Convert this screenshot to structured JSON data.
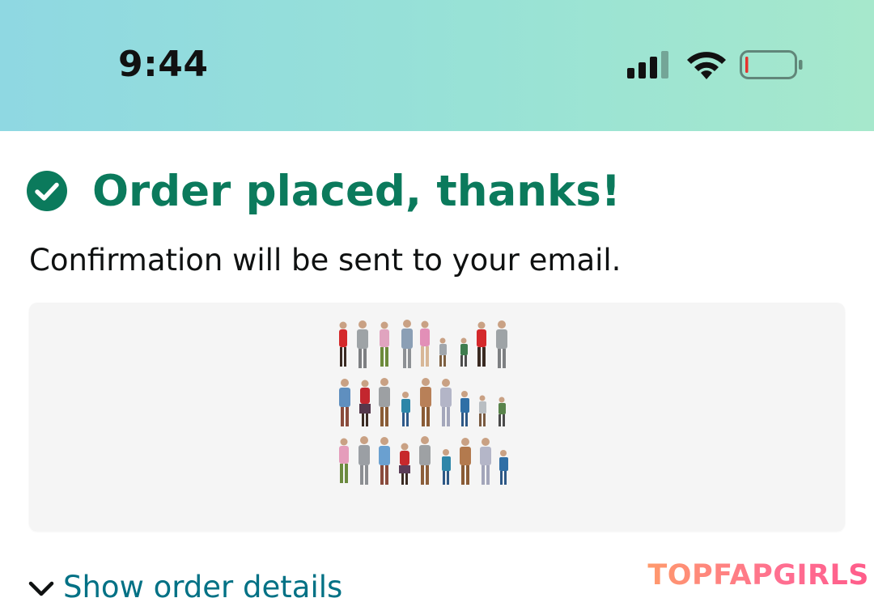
{
  "status_bar": {
    "time": "9:44",
    "icons": [
      "cellular-signal-icon",
      "wifi-icon",
      "battery-low-icon"
    ]
  },
  "confirmation": {
    "headline": "Order placed, thanks!",
    "subtext": "Confirmation will be sent to your email.",
    "accent_color": "#0b7a5c",
    "icon": "check-circle-icon"
  },
  "product": {
    "image": "miniature-people-figures-image"
  },
  "details_link": {
    "label": "Show order details",
    "icon": "chevron-down-icon",
    "color": "#007185"
  },
  "watermark": {
    "text": "TOPFAPGIRLS"
  }
}
